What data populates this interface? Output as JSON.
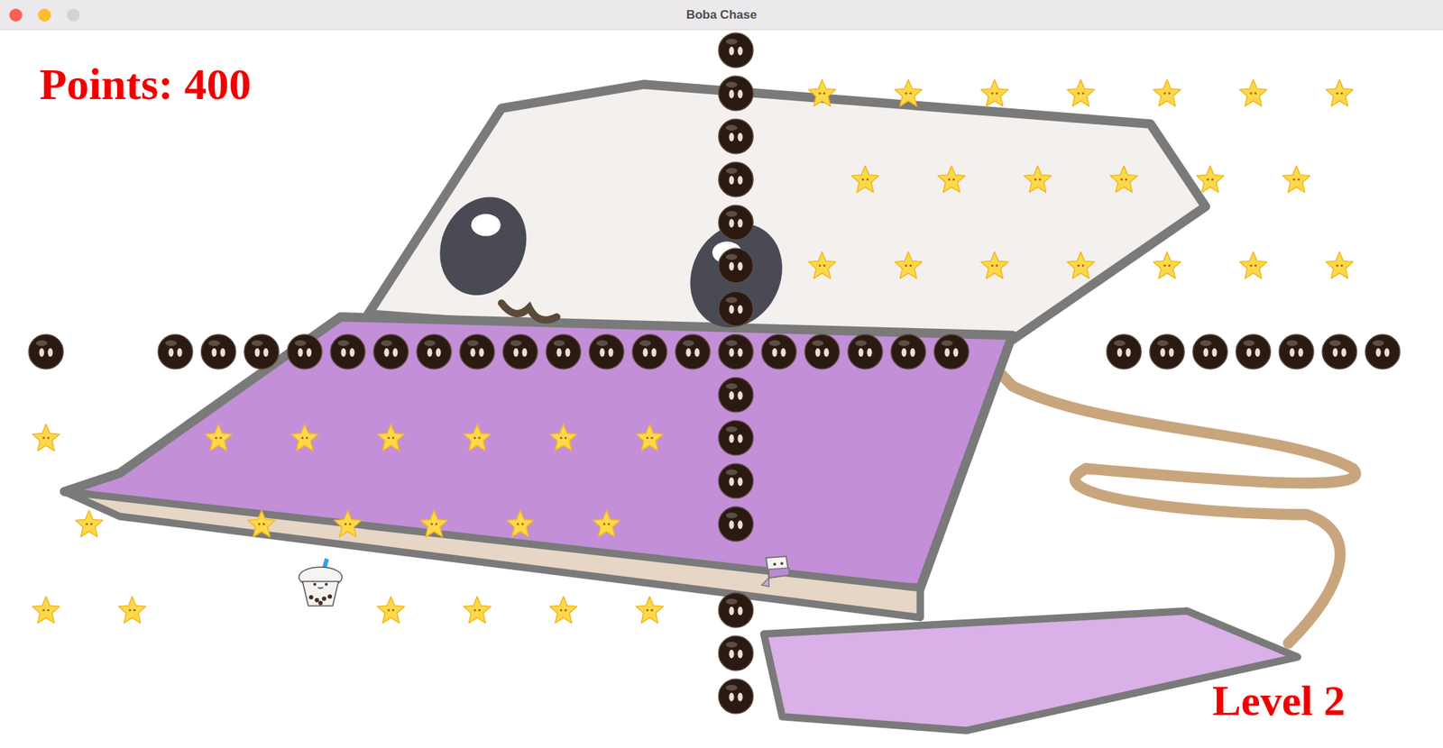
{
  "window": {
    "title": "Boba Chase",
    "controls": [
      {
        "name": "close",
        "disabled": false,
        "color": "#ff5f57"
      },
      {
        "name": "minimize",
        "disabled": false,
        "color": "#febc2e"
      },
      {
        "name": "zoom",
        "disabled": true,
        "color": "#cdcdcd"
      }
    ]
  },
  "hud": {
    "points": "Points: 400",
    "level": "Level 2"
  },
  "board": [
    [
      "empty",
      "empty",
      "empty",
      "empty",
      "empty",
      "empty",
      "empty",
      "empty",
      "empty",
      "empty",
      "empty",
      "empty",
      "empty",
      "empty",
      "empty",
      "empty",
      "pearl",
      "empty",
      "empty",
      "empty",
      "empty",
      "empty",
      "empty",
      "empty",
      "empty",
      "empty",
      "empty",
      "empty",
      "empty",
      "empty",
      "empty",
      "empty"
    ],
    [
      "empty",
      "empty",
      "empty",
      "empty",
      "empty",
      "empty",
      "empty",
      "empty",
      "empty",
      "empty",
      "empty",
      "empty",
      "empty",
      "empty",
      "empty",
      "empty",
      "pearl",
      "empty",
      "star",
      "empty",
      "star",
      "empty",
      "star",
      "empty",
      "star",
      "empty",
      "star",
      "empty",
      "star",
      "empty",
      "star",
      "empty"
    ],
    [
      "empty",
      "empty",
      "empty",
      "empty",
      "empty",
      "empty",
      "empty",
      "empty",
      "empty",
      "empty",
      "empty",
      "empty",
      "empty",
      "empty",
      "empty",
      "empty",
      "pearl",
      "empty",
      "empty",
      "empty",
      "empty",
      "empty",
      "empty",
      "empty",
      "empty",
      "empty",
      "empty",
      "empty",
      "empty",
      "empty",
      "empty",
      "empty"
    ],
    [
      "empty",
      "empty",
      "empty",
      "empty",
      "empty",
      "empty",
      "empty",
      "empty",
      "empty",
      "empty",
      "empty",
      "empty",
      "empty",
      "empty",
      "empty",
      "empty",
      "pearl",
      "empty",
      "empty",
      "star",
      "empty",
      "star",
      "empty",
      "star",
      "empty",
      "star",
      "empty",
      "star",
      "empty",
      "star",
      "empty",
      "empty"
    ],
    [
      "empty",
      "empty",
      "empty",
      "empty",
      "empty",
      "empty",
      "empty",
      "empty",
      "empty",
      "empty",
      "empty",
      "empty",
      "empty",
      "empty",
      "empty",
      "empty",
      "pearl",
      "empty",
      "empty",
      "empty",
      "empty",
      "empty",
      "empty",
      "empty",
      "empty",
      "empty",
      "empty",
      "empty",
      "empty",
      "empty",
      "empty",
      "empty"
    ],
    [
      "empty",
      "empty",
      "empty",
      "empty",
      "empty",
      "empty",
      "empty",
      "empty",
      "empty",
      "empty",
      "empty",
      "empty",
      "empty",
      "empty",
      "empty",
      "empty",
      "pearl",
      "empty",
      "star",
      "empty",
      "star",
      "empty",
      "star",
      "empty",
      "star",
      "empty",
      "star",
      "empty",
      "star",
      "empty",
      "star",
      "empty"
    ],
    [
      "empty",
      "empty",
      "empty",
      "empty",
      "empty",
      "empty",
      "empty",
      "empty",
      "empty",
      "empty",
      "empty",
      "empty",
      "empty",
      "empty",
      "empty",
      "empty",
      "pearl",
      "empty",
      "empty",
      "empty",
      "empty",
      "empty",
      "empty",
      "empty",
      "empty",
      "empty",
      "empty",
      "empty",
      "empty",
      "empty",
      "empty",
      "empty"
    ],
    [
      "pearl",
      "empty",
      "empty",
      "pearl",
      "pearl",
      "pearl",
      "pearl",
      "pearl",
      "pearl",
      "pearl",
      "pearl",
      "pearl",
      "pearl",
      "pearl",
      "pearl",
      "pearl",
      "pearl",
      "pearl",
      "pearl",
      "pearl",
      "pearl",
      "pearl",
      "empty",
      "empty",
      "empty",
      "pearl",
      "pearl",
      "pearl",
      "pearl",
      "pearl",
      "pearl",
      "pearl"
    ],
    [
      "empty",
      "empty",
      "empty",
      "empty",
      "empty",
      "empty",
      "empty",
      "empty",
      "empty",
      "empty",
      "empty",
      "empty",
      "empty",
      "empty",
      "empty",
      "empty",
      "pearl",
      "empty",
      "empty",
      "empty",
      "empty",
      "empty",
      "empty",
      "empty",
      "empty",
      "empty",
      "empty",
      "empty",
      "empty",
      "empty",
      "empty",
      "empty"
    ],
    [
      "star",
      "empty",
      "empty",
      "empty",
      "star",
      "empty",
      "star",
      "empty",
      "star",
      "empty",
      "star",
      "empty",
      "star",
      "empty",
      "star",
      "empty",
      "pearl",
      "empty",
      "empty",
      "empty",
      "empty",
      "empty",
      "empty",
      "empty",
      "empty",
      "empty",
      "empty",
      "empty",
      "empty",
      "empty",
      "empty",
      "empty"
    ],
    [
      "empty",
      "empty",
      "empty",
      "empty",
      "empty",
      "empty",
      "empty",
      "empty",
      "empty",
      "empty",
      "empty",
      "empty",
      "empty",
      "empty",
      "empty",
      "empty",
      "pearl",
      "empty",
      "empty",
      "empty",
      "empty",
      "empty",
      "empty",
      "empty",
      "empty",
      "empty",
      "empty",
      "empty",
      "empty",
      "empty",
      "empty",
      "empty"
    ],
    [
      "empty",
      "star",
      "empty",
      "empty",
      "empty",
      "star",
      "empty",
      "star",
      "empty",
      "star",
      "empty",
      "star",
      "empty",
      "star",
      "empty",
      "empty",
      "pearl",
      "empty",
      "empty",
      "empty",
      "empty",
      "empty",
      "empty",
      "empty",
      "empty",
      "empty",
      "empty",
      "empty",
      "empty",
      "empty",
      "empty",
      "empty"
    ],
    [
      "empty",
      "empty",
      "empty",
      "empty",
      "empty",
      "empty",
      "player",
      "empty",
      "empty",
      "empty",
      "empty",
      "empty",
      "empty",
      "empty",
      "empty",
      "empty",
      "empty",
      "enemy",
      "empty",
      "empty",
      "empty",
      "empty",
      "empty",
      "empty",
      "empty",
      "empty",
      "empty",
      "empty",
      "empty",
      "empty",
      "empty",
      "empty"
    ],
    [
      "star",
      "empty",
      "star",
      "empty",
      "empty",
      "empty",
      "empty",
      "empty",
      "star",
      "empty",
      "star",
      "empty",
      "star",
      "empty",
      "star",
      "empty",
      "pearl",
      "empty",
      "empty",
      "empty",
      "empty",
      "empty",
      "empty",
      "empty",
      "empty",
      "empty",
      "empty",
      "empty",
      "empty",
      "empty",
      "empty",
      "empty"
    ],
    [
      "empty",
      "empty",
      "empty",
      "empty",
      "empty",
      "empty",
      "empty",
      "empty",
      "empty",
      "empty",
      "empty",
      "empty",
      "empty",
      "empty",
      "empty",
      "empty",
      "pearl",
      "empty",
      "empty",
      "empty",
      "empty",
      "empty",
      "empty",
      "empty",
      "empty",
      "empty",
      "empty",
      "empty",
      "empty",
      "empty",
      "empty",
      "empty"
    ],
    [
      "empty",
      "empty",
      "empty",
      "empty",
      "empty",
      "empty",
      "empty",
      "empty",
      "empty",
      "empty",
      "empty",
      "empty",
      "empty",
      "empty",
      "empty",
      "empty",
      "pearl",
      "empty",
      "empty",
      "empty",
      "empty",
      "empty",
      "empty",
      "empty",
      "empty",
      "empty",
      "empty",
      "empty",
      "empty",
      "empty",
      "empty",
      "empty"
    ]
  ]
}
